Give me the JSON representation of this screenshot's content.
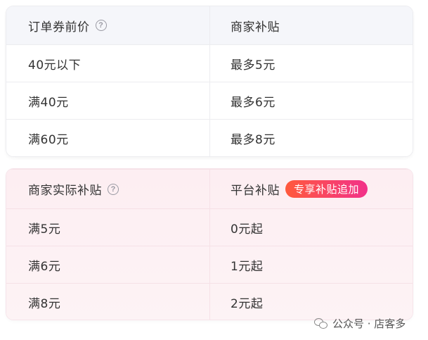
{
  "subsidy_table": {
    "header": {
      "col1": "订单券前价",
      "col2": "商家补贴"
    },
    "rows": [
      {
        "price": "40元以下",
        "subsidy": "最多5元"
      },
      {
        "price": "满40元",
        "subsidy": "最多6元"
      },
      {
        "price": "满60元",
        "subsidy": "最多8元"
      }
    ]
  },
  "platform_table": {
    "header": {
      "col1": "商家实际补贴",
      "col2": "平台补贴",
      "badge": "专享补贴追加"
    },
    "rows": [
      {
        "merchant": "满5元",
        "platform": "0元起"
      },
      {
        "merchant": "满6元",
        "platform": "1元起"
      },
      {
        "merchant": "满8元",
        "platform": "2元起"
      }
    ]
  },
  "icons": {
    "help": "?",
    "help_icon_name": "question-circle-icon",
    "watermark_icon_name": "wechat-icon"
  },
  "watermark": {
    "text": "公众号 · 店客多"
  },
  "colors": {
    "badge_gradient_start": "#ff5a3c",
    "badge_gradient_end": "#f2318a",
    "top_header_bg": "#f5f6fa",
    "bottom_card_bg": "#fdeef2"
  }
}
